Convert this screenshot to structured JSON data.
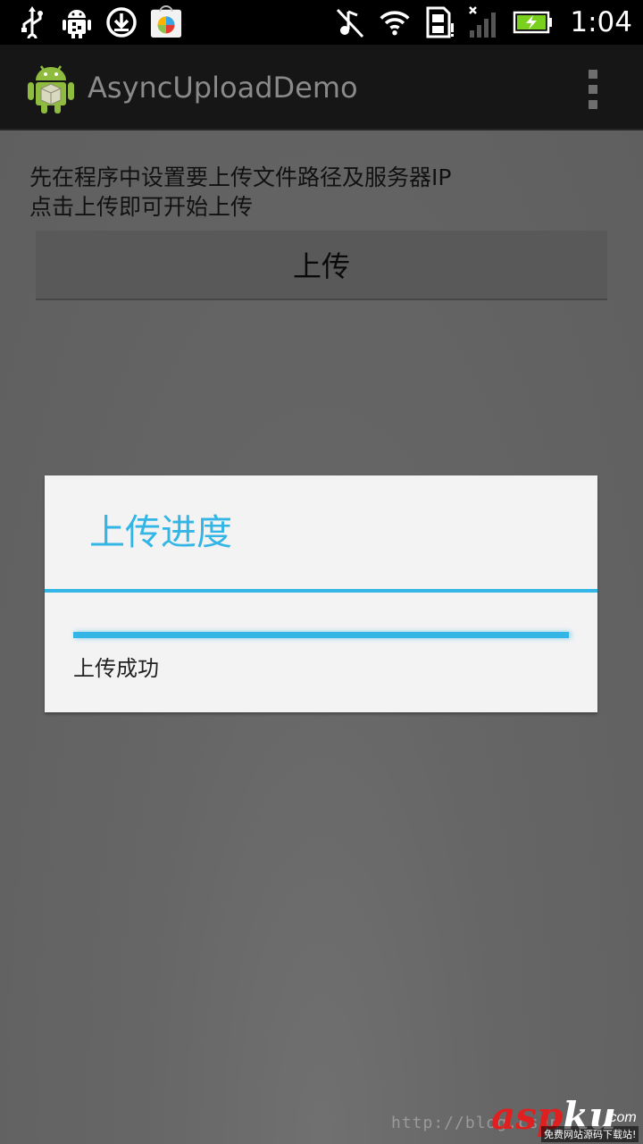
{
  "status_bar": {
    "time": "1:04",
    "icons": [
      "usb-icon",
      "android-debug-icon",
      "download-icon",
      "app-store-icon",
      "mute-music-icon",
      "wifi-icon",
      "sim-card-icon",
      "signal-icon",
      "battery-charging-icon"
    ]
  },
  "action_bar": {
    "app_title": "AsyncUploadDemo",
    "app_icon": "android-app-icon",
    "overflow_icon": "overflow-menu-icon"
  },
  "main": {
    "instruction_line1": "先在程序中设置要上传文件路径及服务器IP",
    "instruction_line2": "点击上传即可开始上传",
    "upload_button_label": "上传"
  },
  "dialog": {
    "title": "上传进度",
    "message": "上传成功",
    "progress": 1.0
  },
  "watermark": {
    "url": "http://blog.csdn",
    "logo_asp": "asp",
    "logo_ku": "ku",
    "tld": ".com",
    "slogan": "免费网站源码下载站!"
  },
  "colors": {
    "accent": "#33b5e5",
    "dim_overlay": "#666666",
    "dialog_bg": "#f3f3f3"
  }
}
